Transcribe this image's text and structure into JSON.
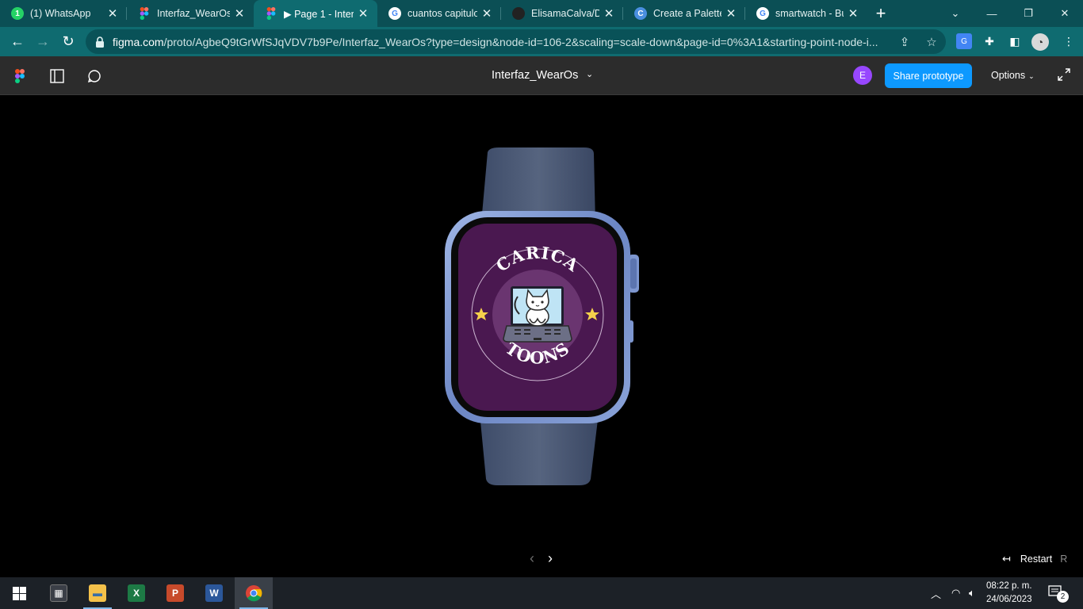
{
  "browser": {
    "tabs": [
      {
        "title": "(1) WhatsApp",
        "favicon": "whatsapp-icon",
        "badge": "1"
      },
      {
        "title": "Interfaz_WearOs",
        "favicon": "figma-icon"
      },
      {
        "title": "▶ Page 1 - Interf",
        "favicon": "figma-icon",
        "active": true
      },
      {
        "title": "cuantos capitulo",
        "favicon": "google-icon"
      },
      {
        "title": "ElisamaCalva/DD",
        "favicon": "github-icon"
      },
      {
        "title": "Create a Palette",
        "favicon": "coolors-icon"
      },
      {
        "title": "smartwatch - Bus",
        "favicon": "google-icon"
      }
    ],
    "url_domain": "figma.com",
    "url_path": "/proto/AgbeQ9tGrWfSJqVDV7b9Pe/Interfaz_WearOs?type=design&node-id=106-2&scaling=scale-down&page-id=0%3A1&starting-point-node-i..."
  },
  "figma": {
    "file_title": "Interfaz_WearOs",
    "avatar_initial": "E",
    "share_label": "Share prototype",
    "options_label": "Options",
    "restart_label": "Restart",
    "restart_key": "R"
  },
  "watch_face": {
    "brand_top": "CARICA",
    "brand_bottom": "TOONS"
  },
  "taskbar": {
    "time": "08:22 p. m.",
    "date": "24/06/2023",
    "notifications": "2"
  },
  "colors": {
    "tab_strip": "#0b4f55",
    "toolbar": "#0f6b70",
    "figma_header": "#2c2c2c",
    "accent": "#0d99ff",
    "watch_screen": "#4a1850",
    "avatar": "#9747ff"
  }
}
